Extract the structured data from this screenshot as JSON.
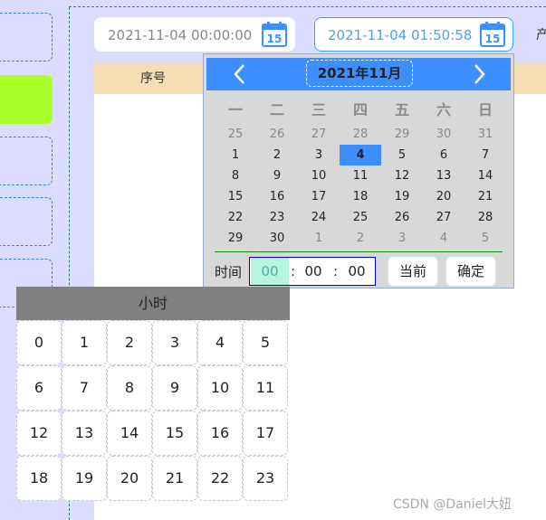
{
  "date_range": {
    "start_value": "2021-11-04 00:00:00",
    "end_value": "2021-11-04 01:50:58",
    "calendar_icon_day": "15",
    "trailing_text": "产"
  },
  "table": {
    "header": {
      "col_1": "序号"
    }
  },
  "calendar": {
    "prev_icon": "chevron-left-icon",
    "next_icon": "chevron-right-icon",
    "month_title": "2021年11月",
    "weekdays": [
      "一",
      "二",
      "三",
      "四",
      "五",
      "六",
      "日"
    ],
    "days": [
      {
        "d": "25",
        "other": true
      },
      {
        "d": "26",
        "other": true
      },
      {
        "d": "27",
        "other": true
      },
      {
        "d": "28",
        "other": true
      },
      {
        "d": "29",
        "other": true
      },
      {
        "d": "30",
        "other": true
      },
      {
        "d": "31",
        "other": true
      },
      {
        "d": "1"
      },
      {
        "d": "2"
      },
      {
        "d": "3"
      },
      {
        "d": "4",
        "selected": true
      },
      {
        "d": "5"
      },
      {
        "d": "6"
      },
      {
        "d": "7"
      },
      {
        "d": "8"
      },
      {
        "d": "9"
      },
      {
        "d": "10"
      },
      {
        "d": "11"
      },
      {
        "d": "12"
      },
      {
        "d": "13"
      },
      {
        "d": "14"
      },
      {
        "d": "15"
      },
      {
        "d": "16"
      },
      {
        "d": "17"
      },
      {
        "d": "18"
      },
      {
        "d": "19"
      },
      {
        "d": "20"
      },
      {
        "d": "21"
      },
      {
        "d": "22"
      },
      {
        "d": "23"
      },
      {
        "d": "24"
      },
      {
        "d": "25"
      },
      {
        "d": "26"
      },
      {
        "d": "27"
      },
      {
        "d": "28"
      },
      {
        "d": "29"
      },
      {
        "d": "30"
      },
      {
        "d": "1",
        "other": true
      },
      {
        "d": "2",
        "other": true
      },
      {
        "d": "3",
        "other": true
      },
      {
        "d": "4",
        "other": true
      },
      {
        "d": "5",
        "other": true
      }
    ],
    "time_label": "时间",
    "time": {
      "hour": "00",
      "minute": "00",
      "second": "00",
      "sep": ":"
    },
    "now_button": "当前",
    "ok_button": "确定"
  },
  "hour_picker": {
    "title": "小时",
    "hours": [
      "0",
      "1",
      "2",
      "3",
      "4",
      "5",
      "6",
      "7",
      "8",
      "9",
      "10",
      "11",
      "12",
      "13",
      "14",
      "15",
      "16",
      "17",
      "18",
      "19",
      "20",
      "21",
      "22",
      "23"
    ]
  },
  "watermark": "CSDN @Daniel大妞",
  "colors": {
    "accent": "#3d8eff",
    "sidebar_active": "#a8ff2a",
    "table_header": "#f5deb3",
    "hour_highlight": "#b6f5dd"
  }
}
